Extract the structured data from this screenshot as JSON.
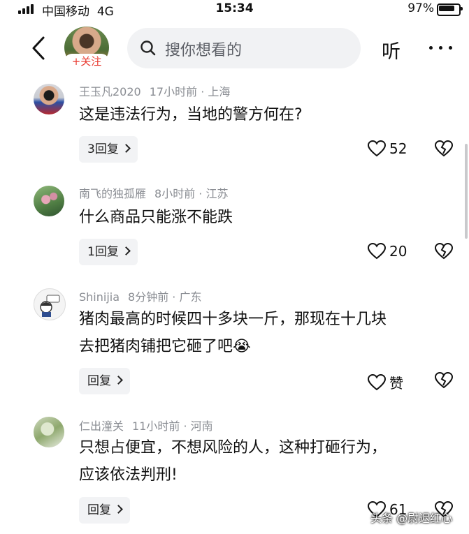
{
  "status_bar": {
    "carrier": "中国移动",
    "network": "4G",
    "time": "15:34",
    "battery": "97%"
  },
  "header": {
    "follow_label": "+关注",
    "search_placeholder": "搜你想看的",
    "listen_label": "听"
  },
  "comments": [
    {
      "author": "王玉凡2020",
      "time": "17小时前",
      "location": "上海",
      "lines": [
        "这是违法行为，当地的警方何在?"
      ],
      "reply_label": "3回复",
      "likes": "52"
    },
    {
      "author": "南飞的独孤雁",
      "time": "8小时前",
      "location": "江苏",
      "lines": [
        "什么商品只能涨不能跌"
      ],
      "reply_label": "1回复",
      "likes": "20"
    },
    {
      "author": "Shinijia",
      "time": "8分钟前",
      "location": "广东",
      "lines": [
        "猪肉最高的时候四十多块一斤，那现在十几块",
        "去把猪肉铺把它砸了吧"
      ],
      "emoji": "😭",
      "reply_label": "回复",
      "likes": "赞"
    },
    {
      "author": "仁出潼关",
      "time": "11小时前",
      "location": "河南",
      "lines": [
        "只想占便宜，不想风险的人，这种打砸行为，",
        "应该依法判刑!"
      ],
      "reply_label": "回复",
      "likes": "61"
    }
  ],
  "watermark": "头条 @尉迟红心",
  "colors": {
    "accent_red": "#e8392f",
    "meta_gray": "#8a8d93",
    "pill_bg": "#f2f3f5"
  },
  "icons": [
    "back-icon",
    "search-icon",
    "more-icon",
    "heart-icon",
    "heart-broken-icon"
  ]
}
